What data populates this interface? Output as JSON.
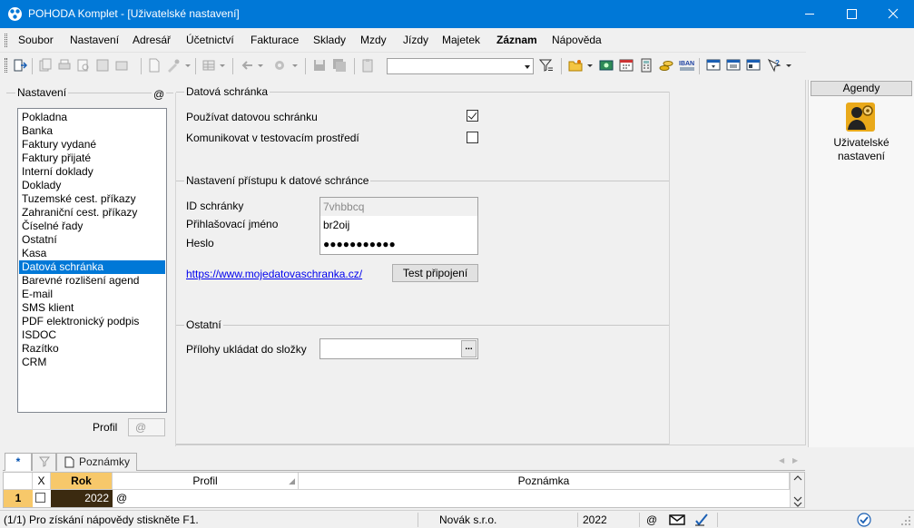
{
  "window": {
    "title": "POHODA Komplet - [Uživatelské nastavení]"
  },
  "menu": [
    "Soubor",
    "Nastavení",
    "Adresář",
    "Účetnictví",
    "Fakturace",
    "Sklady",
    "Mzdy",
    "Jízdy",
    "Majetek",
    "Záznam",
    "Nápověda"
  ],
  "left": {
    "group_title": "Nastavení",
    "at": "@",
    "items": [
      "Pokladna",
      "Banka",
      "Faktury vydané",
      "Faktury přijaté",
      "Interní doklady",
      "Doklady",
      "Tuzemské cest. příkazy",
      "Zahraniční cest. příkazy",
      "Číselné řady",
      "Ostatní",
      "Kasa",
      "Datová schránka",
      "Barevné rozlišení agend",
      "E-mail",
      "SMS klient",
      "PDF elektronický podpis",
      "ISDOC",
      "Razítko",
      "CRM"
    ],
    "selected_index": 11,
    "profil_label": "Profil",
    "profil_value": "@"
  },
  "main": {
    "section1": "Datová schránka",
    "use_label": "Používat datovou schránku",
    "use_checked": true,
    "test_env_label": "Komunikovat v testovacím prostředí",
    "test_env_checked": false,
    "section2": "Nastavení přístupu k datové schránce",
    "id_label": "ID schránky",
    "id_value": "7vhbbcq",
    "login_label": "Přihlašovací jméno",
    "login_value": "br2oij",
    "password_label": "Heslo",
    "password_value": "●●●●●●●●●●●",
    "link": "https://www.mojedatovaschranka.cz/",
    "test_button": "Test připojení",
    "section3": "Ostatní",
    "attachments_label": "Přílohy ukládat do složky",
    "attachments_value": "",
    "browse_button": "..."
  },
  "right": {
    "header": "Agendy",
    "item_line1": "Uživatelské",
    "item_line2": "nastavení"
  },
  "tabs": {
    "star": "*",
    "notes": "Poznámky"
  },
  "grid": {
    "headers": {
      "x": "X",
      "rok": "Rok",
      "profil": "Profil",
      "poznamka": "Poznámka"
    },
    "rows": [
      {
        "num": "1",
        "rok": "2022",
        "profil": "@",
        "poznamka": ""
      }
    ]
  },
  "status": {
    "help": "(1/1) Pro získání nápovědy stiskněte F1.",
    "company": "Novák s.r.o.",
    "year": "2022",
    "at": "@"
  },
  "colors": {
    "titlebar": "#0078d7",
    "selection": "#0078d7",
    "accent_orange": "#f7c86a",
    "link": "#0000ee"
  }
}
